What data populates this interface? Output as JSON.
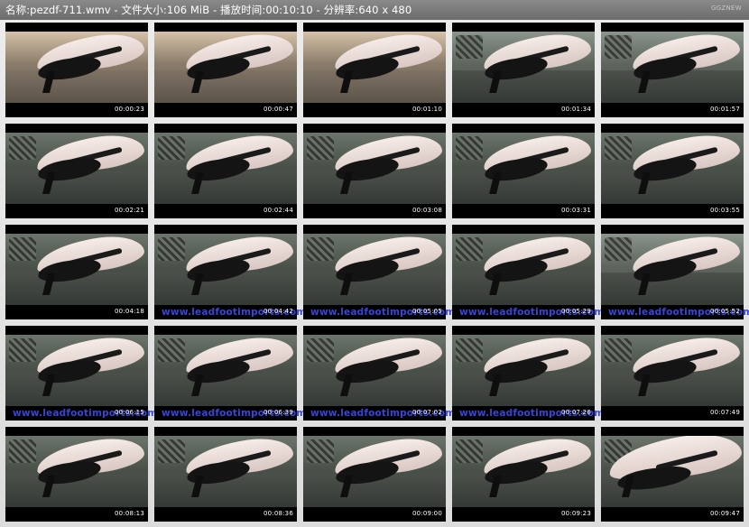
{
  "header": {
    "title": "名称:pezdf-711.wmv - 文件大小:106 MiB - 播放时间:00:10:10 - 分辨率:640 x 480",
    "mark": "GGZNEW"
  },
  "watermark_text": "www.leadfootimports.com",
  "thumbnails": [
    {
      "time": "00:00:23",
      "watermark": false,
      "style": "warm"
    },
    {
      "time": "00:00:47",
      "watermark": false,
      "style": "warm"
    },
    {
      "time": "00:01:10",
      "watermark": false,
      "style": "warm"
    },
    {
      "time": "00:01:34",
      "watermark": false,
      "style": "pale"
    },
    {
      "time": "00:01:57",
      "watermark": false,
      "style": "pale"
    },
    {
      "time": "00:02:21",
      "watermark": false,
      "style": "normal"
    },
    {
      "time": "00:02:44",
      "watermark": false,
      "style": "normal"
    },
    {
      "time": "00:03:08",
      "watermark": false,
      "style": "normal"
    },
    {
      "time": "00:03:31",
      "watermark": false,
      "style": "normal"
    },
    {
      "time": "00:03:55",
      "watermark": false,
      "style": "normal"
    },
    {
      "time": "00:04:18",
      "watermark": false,
      "style": "normal"
    },
    {
      "time": "00:04:42",
      "watermark": true,
      "style": "normal"
    },
    {
      "time": "00:05:05",
      "watermark": true,
      "style": "normal"
    },
    {
      "time": "00:05:29",
      "watermark": true,
      "style": "normal"
    },
    {
      "time": "00:05:52",
      "watermark": true,
      "style": "pale"
    },
    {
      "time": "00:06:15",
      "watermark": true,
      "style": "normal"
    },
    {
      "time": "00:06:39",
      "watermark": true,
      "style": "normal"
    },
    {
      "time": "00:07:02",
      "watermark": true,
      "style": "normal"
    },
    {
      "time": "00:07:26",
      "watermark": true,
      "style": "normal"
    },
    {
      "time": "00:07:49",
      "watermark": false,
      "style": "normal"
    },
    {
      "time": "00:08:13",
      "watermark": false,
      "style": "normal"
    },
    {
      "time": "00:08:36",
      "watermark": false,
      "style": "normal"
    },
    {
      "time": "00:09:00",
      "watermark": false,
      "style": "normal"
    },
    {
      "time": "00:09:23",
      "watermark": false,
      "style": "normal"
    },
    {
      "time": "00:09:47",
      "watermark": false,
      "style": "close"
    }
  ],
  "colors": {
    "header_bg": "#7a7a7a",
    "page_bg": "#e4e4e4",
    "watermark": "#3a44d8",
    "timestamp": "#ffffff"
  }
}
